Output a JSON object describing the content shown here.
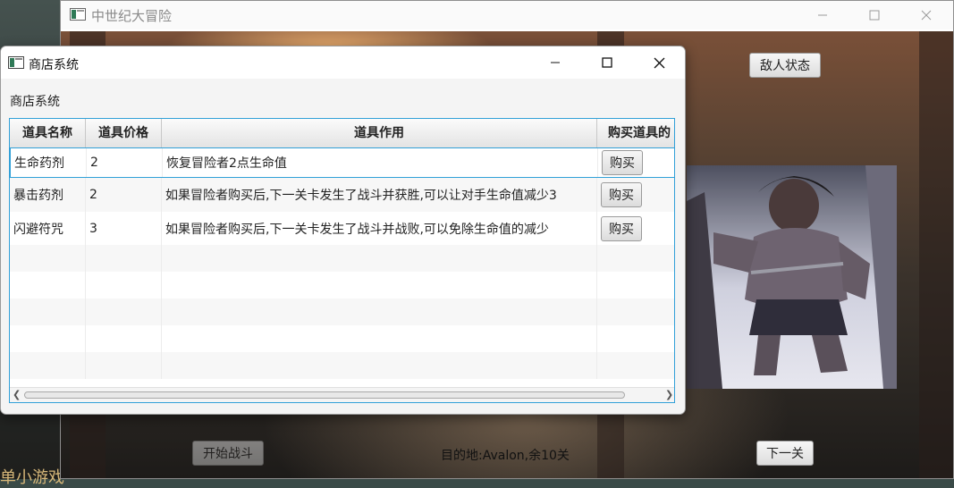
{
  "desktop": {
    "bg_text": "单小游戏"
  },
  "main_window": {
    "title": "中世纪大冒险",
    "enemy_status_button": "敌人状态",
    "start_battle_button": "开始战斗",
    "status_text": "目的地:Avalon,余10关",
    "next_level_button": "下一关",
    "enemy_image": "barbarian-warrior-image"
  },
  "shop": {
    "title": "商店系统",
    "heading": "商店系统",
    "columns": [
      "道具名称",
      "道具价格",
      "道具作用",
      "购买道具的"
    ],
    "rows": [
      {
        "name": "生命药剂",
        "price": "2",
        "effect": "恢复冒险者2点生命值",
        "buy": "购买"
      },
      {
        "name": "暴击药剂",
        "price": "2",
        "effect": "如果冒险者购买后,下一关卡发生了战斗并获胜,可以让对手生命值减少3",
        "buy": "购买"
      },
      {
        "name": "闪避符咒",
        "price": "3",
        "effect": "如果冒险者购买后,下一关卡发生了战斗并战败,可以免除生命值的减少",
        "buy": "购买"
      }
    ]
  },
  "icons": {
    "app": "window-app-icon",
    "minimize": "minimize-icon",
    "maximize": "maximize-icon",
    "close": "close-icon"
  },
  "colors": {
    "selection_border": "#31a0d8"
  }
}
